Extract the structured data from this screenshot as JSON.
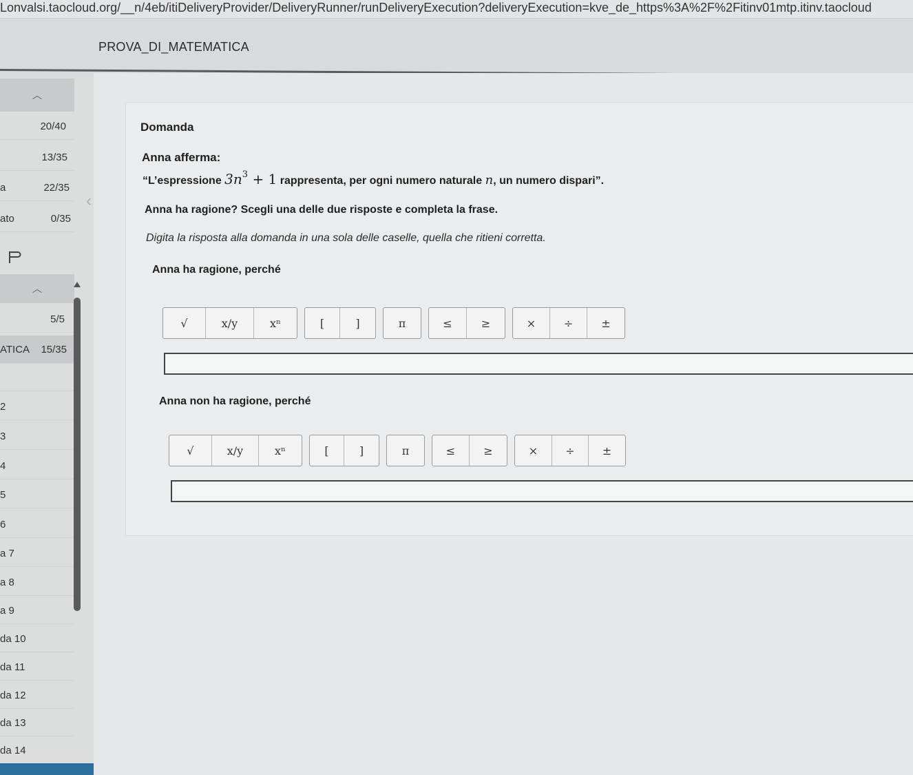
{
  "browser": {
    "url": "Lonvalsi.taocloud.org/__n/4eb/itiDeliveryProvider/DeliveryRunner/runDeliveryExecution?deliveryExecution=kve_de_https%3A%2F%2Fitinv01mtp.itinv.taocloud"
  },
  "test": {
    "title": "PROVA_DI_MATEMATICA"
  },
  "sidebar": {
    "sections_top": [
      {
        "name": "",
        "count": "20/40"
      },
      {
        "name": "",
        "count": "13/35"
      },
      {
        "name": "a",
        "count": "22/35"
      },
      {
        "name": "ato",
        "count": "0/35"
      }
    ],
    "current_section": {
      "count": "5/5"
    },
    "current_test": {
      "name": "ATICA",
      "count": "15/35"
    },
    "items": [
      "",
      "2",
      "3",
      "4",
      "5",
      "6",
      "a 7",
      "a 8",
      "a 9",
      "da 10",
      "da 11",
      "da 12",
      "da 13",
      "da 14"
    ]
  },
  "question": {
    "heading": "Domanda",
    "intro": "Anna afferma:",
    "quote_before": "“L’espressione",
    "expr_coef": "3",
    "expr_var": "n",
    "expr_exp": "3",
    "expr_rest": "+ 1",
    "quote_after": "rappresenta, per ogni numero naturale",
    "quote_var": "n",
    "quote_end": ", un numero dispari”.",
    "ask": "Anna ha ragione? Scegli una delle due risposte e completa la frase.",
    "instructions": "Digita la risposta alla domanda in una sola delle caselle, quella che ritieni corretta."
  },
  "options": [
    {
      "label": "Anna ha ragione, perché"
    },
    {
      "label": "Anna non ha ragione, perché"
    }
  ],
  "toolbar": {
    "sqrt": "√",
    "fraction": "x/y",
    "power": "xⁿ",
    "bracket_open": "[",
    "bracket_close": "]",
    "pi": "π",
    "leq": "≤",
    "geq": "≥",
    "times": "×",
    "divide": "÷",
    "plusminus": "±"
  }
}
